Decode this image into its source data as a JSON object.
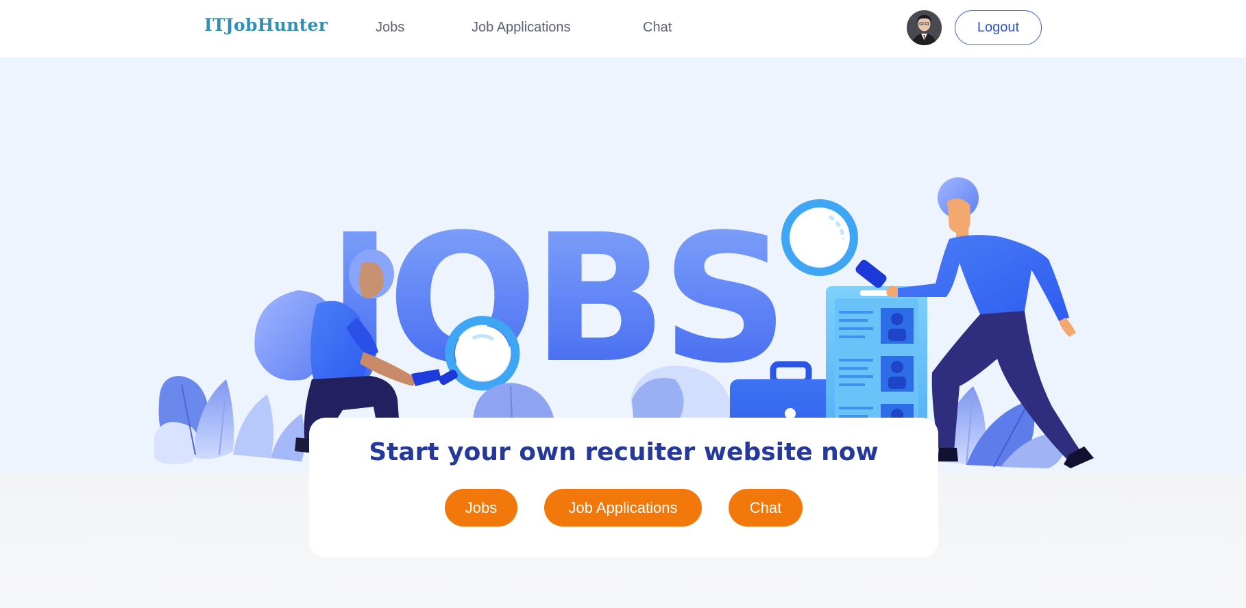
{
  "header": {
    "brand": "ITJobHunter",
    "nav": {
      "jobs": "Jobs",
      "applications": "Job Applications",
      "chat": "Chat"
    },
    "logout_label": "Logout"
  },
  "hero": {
    "illustration_text": "JOBS"
  },
  "cta": {
    "title": "Start your own recuiter website now",
    "buttons": {
      "jobs": "Jobs",
      "applications": "Job Applications",
      "chat": "Chat"
    }
  },
  "colors": {
    "brand": "#2f8fb9",
    "accent": "#f3780c",
    "primary_blue": "#2d55d3",
    "title_navy": "#25389c",
    "hero_bg": "#edf4fd"
  },
  "icons": {
    "avatar": "user-avatar",
    "illustration": "job-search-illustration"
  }
}
